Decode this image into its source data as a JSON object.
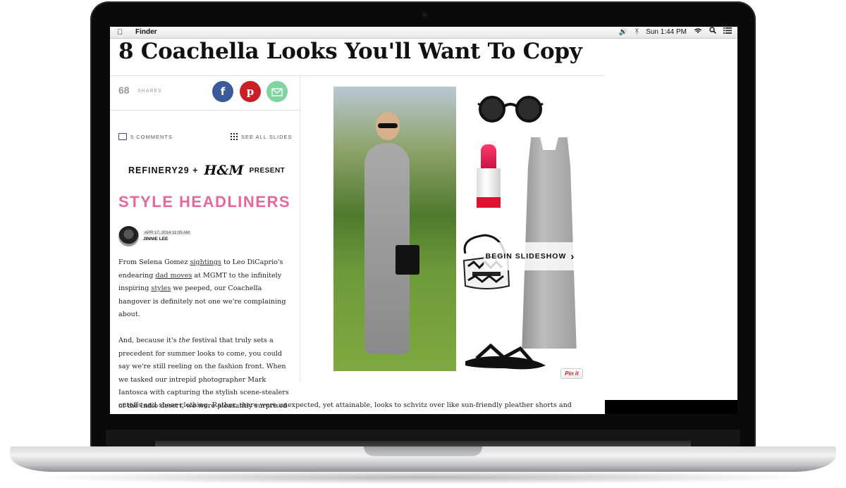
{
  "menubar": {
    "app": "Finder",
    "clock": "Sun 1:44 PM"
  },
  "article": {
    "headline": "8 Coachella Looks You'll Want To Copy",
    "shares_count": "68",
    "shares_label": "SHARES",
    "comments_label": "5 COMMENTS",
    "see_all_label": "SEE ALL SLIDES",
    "sponsor_r29": "REFINERY29 +",
    "sponsor_hm": "H&M",
    "sponsor_present": "PRESENT",
    "style_headliners": "STYLE HEADLINERS",
    "author_date": "APR 17, 2014 11:05 AM",
    "author_name": "JINNIE LEE",
    "p1_a": "From Selena Gomez ",
    "p1_link1": "sightings",
    "p1_b": " to Leo DiCaprio's endearing ",
    "p1_link2": "dad moves",
    "p1_c": " at MGMT to the infinitely inspiring ",
    "p1_link3": "styles",
    "p1_d": " we peeped, our Coachella hangover is definitely not one we're complaining about.",
    "p2_a": "And, because it's ",
    "p2_em": "the",
    "p2_b": " festival that truly sets a precedent for summer looks to come, you could say we're still reeling on the fashion front. When we tasked our intrepid photographer Mark Iantosca with capturing the stylish scene-stealers of the Indio desert, we were pleasantly surprised to see outfits beyond the usual",
    "p2_wide": "cutoffs and sheer clothing. Rather, there were unexpected, yet attainable, looks to schvitz over like sun-friendly pleather shorts and summertime booties (who needs sandals?) that are perfect for the coming months."
  },
  "slideshow": {
    "begin_label": "BEGIN SLIDESHOW",
    "pinit_label": "Pin it"
  },
  "colors": {
    "facebook": "#3b5a9a",
    "pinterest": "#cb1f27",
    "mail": "#7fd49f",
    "style_headliners": "#e8679b"
  },
  "icons": [
    "apple-icon",
    "volume-icon",
    "bluetooth-icon",
    "wifi-icon",
    "spotlight-search-icon",
    "notification-list-icon",
    "facebook-icon",
    "pinterest-icon",
    "mail-icon",
    "comment-icon",
    "grid-icon",
    "chevron-right-icon"
  ]
}
